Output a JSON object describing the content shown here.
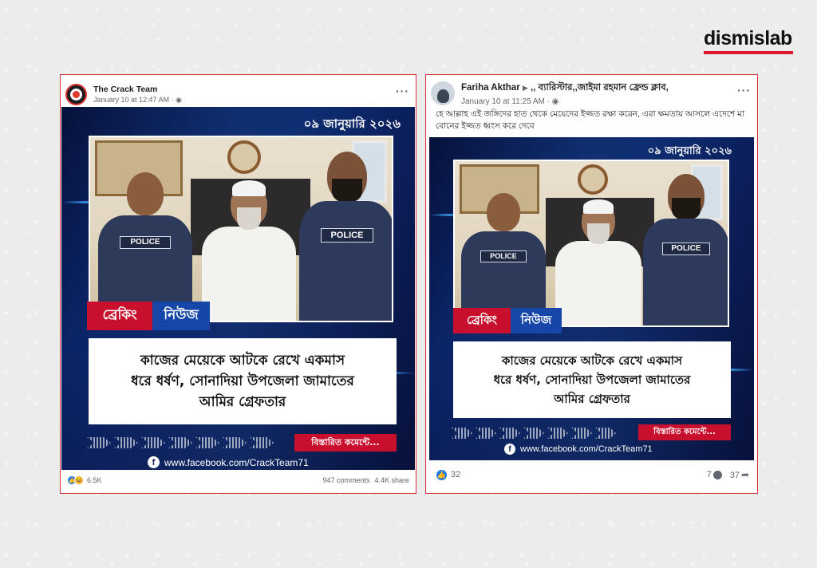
{
  "brand": {
    "logo_text": "dismislab",
    "accent": "#e0182d"
  },
  "posts": [
    {
      "author": "The Crack Team",
      "time": "January 10 at 12:47 AM · ",
      "menu": "···",
      "caption": "",
      "card": {
        "date": "০৯ জানুয়ারি ২০২৬",
        "tag_red": "ব্রেকিং",
        "tag_blue": "নিউজ",
        "headline_line1": "কাজের মেয়েকে আটকে রেখে একমাস",
        "headline_line2": "ধরে ধর্ষণ, সোনাদিয়া উপজেলা জামাতের",
        "headline_line3": "আমির গ্রেফতার",
        "details": "বিস্তারিত কমেন্টে...",
        "site": "www.facebook.com/CrackTeam71",
        "vest_label": "POLICE"
      },
      "reactions": "6.5K",
      "comments": "947 comments",
      "shares": "4.4K share"
    },
    {
      "author": "Fariha Akthar",
      "group": ",, ব্যারিস্টার,,জাইমা রহমান ফ্রেন্ড ক্লাব,",
      "time": "January 10 at 11:25 AM · ",
      "menu": "···",
      "caption": "হে আল্লাহ এই জঙ্গিদের হাত থেকে মেয়েদের ইজ্জত রক্ষা করেন, এরা ক্ষমতায় আসলে এদেশে মা বোনের ইজ্জত ধ্বংস করে দেবে",
      "card": {
        "date": "০৯ জানুয়ারি ২০২৬",
        "tag_red": "ব্রেকিং",
        "tag_blue": "নিউজ",
        "headline_line1": "কাজের মেয়েকে আটকে রেখে একমাস",
        "headline_line2": "ধরে ধর্ষণ, সোনাদিয়া উপজেলা জামাতের",
        "headline_line3": "আমির গ্রেফতার",
        "details": "বিস্তারিত কমেন্টে...",
        "site": "www.facebook.com/CrackTeam71",
        "vest_label": "POLICE"
      },
      "reactions": "32",
      "comments": "7",
      "shares": "37"
    }
  ]
}
